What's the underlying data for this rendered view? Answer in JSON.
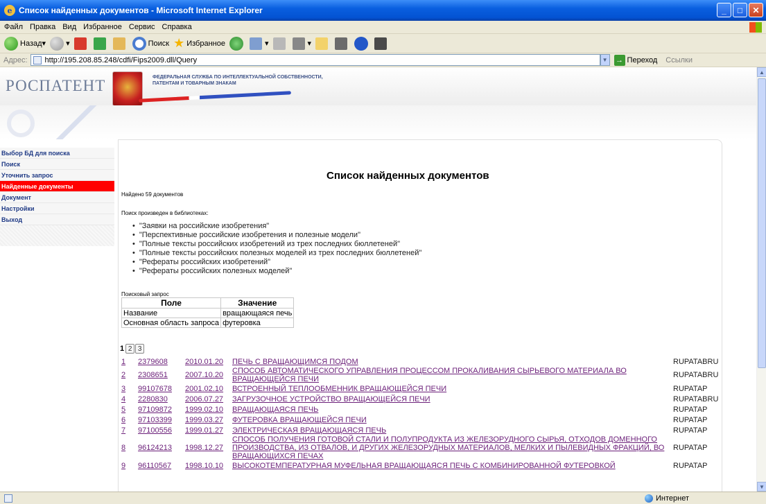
{
  "window": {
    "title": "Список найденных документов - Microsoft Internet Explorer"
  },
  "menubar": [
    "Файл",
    "Правка",
    "Вид",
    "Избранное",
    "Сервис",
    "Справка"
  ],
  "toolbar": {
    "back": "Назад",
    "search": "Поиск",
    "favorites": "Избранное"
  },
  "address": {
    "label": "Адрес:",
    "url": "http://195.208.85.248/cdfi/Fips2009.dll/Query",
    "go": "Переход",
    "links": "Ссылки"
  },
  "status": {
    "zone": "Интернет"
  },
  "header": {
    "logo": "РОСПАТЕНТ",
    "agency_line1": "ФЕДЕРАЛЬНАЯ СЛУЖБА ПО ИНТЕЛЛЕКТУАЛЬНОЙ СОБСТВЕННОСТИ,",
    "agency_line2": "ПАТЕНТАМ И ТОВАРНЫМ ЗНАКАМ"
  },
  "sidebar": {
    "items": [
      {
        "label": "Выбор БД для поиска"
      },
      {
        "label": "Поиск"
      },
      {
        "label": "Уточнить запрос"
      },
      {
        "label": "Найденные документы"
      },
      {
        "label": "Документ"
      },
      {
        "label": "Настройки"
      },
      {
        "label": "Выход"
      }
    ]
  },
  "main": {
    "title": "Список найденных документов",
    "found": "Найдено 59 документов",
    "libraries_caption": "Поиск произведен в библиотеках:",
    "libraries": [
      "\"Заявки на российские изобретения\"",
      "\"Перспективные российские изобретения и полезные модели\"",
      "\"Полные тексты российских изобретений из трех последних бюллетеней\"",
      "\"Полные тексты российских полезных моделей из трех последних бюллетеней\"",
      "\"Рефераты российских изобретений\"",
      "\"Рефераты российских полезных моделей\""
    ],
    "query_caption": "Поисковый запрос",
    "query_table": {
      "headers": [
        "Поле",
        "Значение"
      ],
      "rows": [
        [
          "Название",
          "вращающаяся печь"
        ],
        [
          "Основная область запроса",
          "футеровка"
        ]
      ]
    },
    "pager": {
      "current": "1",
      "pages": [
        "2",
        "3"
      ]
    },
    "results": [
      {
        "n": "1",
        "id": "2379608",
        "date": "2010.01.20",
        "title": "ПЕЧЬ С ВРАЩАЮЩИМСЯ ПОДОМ",
        "src": "RUPATABRU"
      },
      {
        "n": "2",
        "id": "2308651",
        "date": "2007.10.20",
        "title": "СПОСОБ АВТОМАТИЧЕСКОГО УПРАВЛЕНИЯ ПРОЦЕССОМ ПРОКАЛИВАНИЯ СЫРЬЕВОГО МАТЕРИАЛА ВО ВРАЩАЮЩЕЙСЯ ПЕЧИ",
        "src": "RUPATABRU"
      },
      {
        "n": "3",
        "id": "99107678",
        "date": "2001.02.10",
        "title": "ВСТРОЕННЫЙ ТЕПЛООБМЕННИК ВРАЩАЮЩЕЙСЯ ПЕЧИ",
        "src": "RUPATAP"
      },
      {
        "n": "4",
        "id": "2280830",
        "date": "2006.07.27",
        "title": "ЗАГРУЗОЧНОЕ УСТРОЙСТВО ВРАЩАЮЩЕЙСЯ ПЕЧИ",
        "src": "RUPATABRU"
      },
      {
        "n": "5",
        "id": "97109872",
        "date": "1999.02.10",
        "title": "ВРАЩАЮЩАЯСЯ ПЕЧЬ",
        "src": "RUPATAP"
      },
      {
        "n": "6",
        "id": "97103399",
        "date": "1999.03.27",
        "title": "ФУТЕРОВКА ВРАЩАЮЩЕЙСЯ ПЕЧИ",
        "src": "RUPATAP"
      },
      {
        "n": "7",
        "id": "97100556",
        "date": "1999.01.27",
        "title": "ЭЛЕКТРИЧЕСКАЯ ВРАЩАЮЩАЯСЯ ПЕЧЬ",
        "src": "RUPATAP"
      },
      {
        "n": "8",
        "id": "96124213",
        "date": "1998.12.27",
        "title": "СПОСОБ ПОЛУЧЕНИЯ ГОТОВОЙ СТАЛИ И ПОЛУПРОДУКТА ИЗ ЖЕЛЕЗОРУДНОГО СЫРЬЯ, ОТХОДОВ ДОМЕННОГО ПРОИЗВОДСТВА, ИЗ ОТВАЛОВ, И ДРУГИХ ЖЕЛЕЗОРУДНЫХ МАТЕРИАЛОВ, МЕЛКИХ И ПЫЛЕВИДНЫХ ФРАКЦИЙ, ВО ВРАЩАЮЩИХСЯ ПЕЧАХ",
        "src": "RUPATAP"
      },
      {
        "n": "9",
        "id": "96110567",
        "date": "1998.10.10",
        "title": "ВЫСОКОТЕМПЕРАТУРНАЯ МУФЕЛЬНАЯ ВРАЩАЮЩАЯСЯ ПЕЧЬ С КОМБИНИРОВАННОЙ ФУТЕРОВКОЙ",
        "src": "RUPATAP"
      }
    ]
  }
}
